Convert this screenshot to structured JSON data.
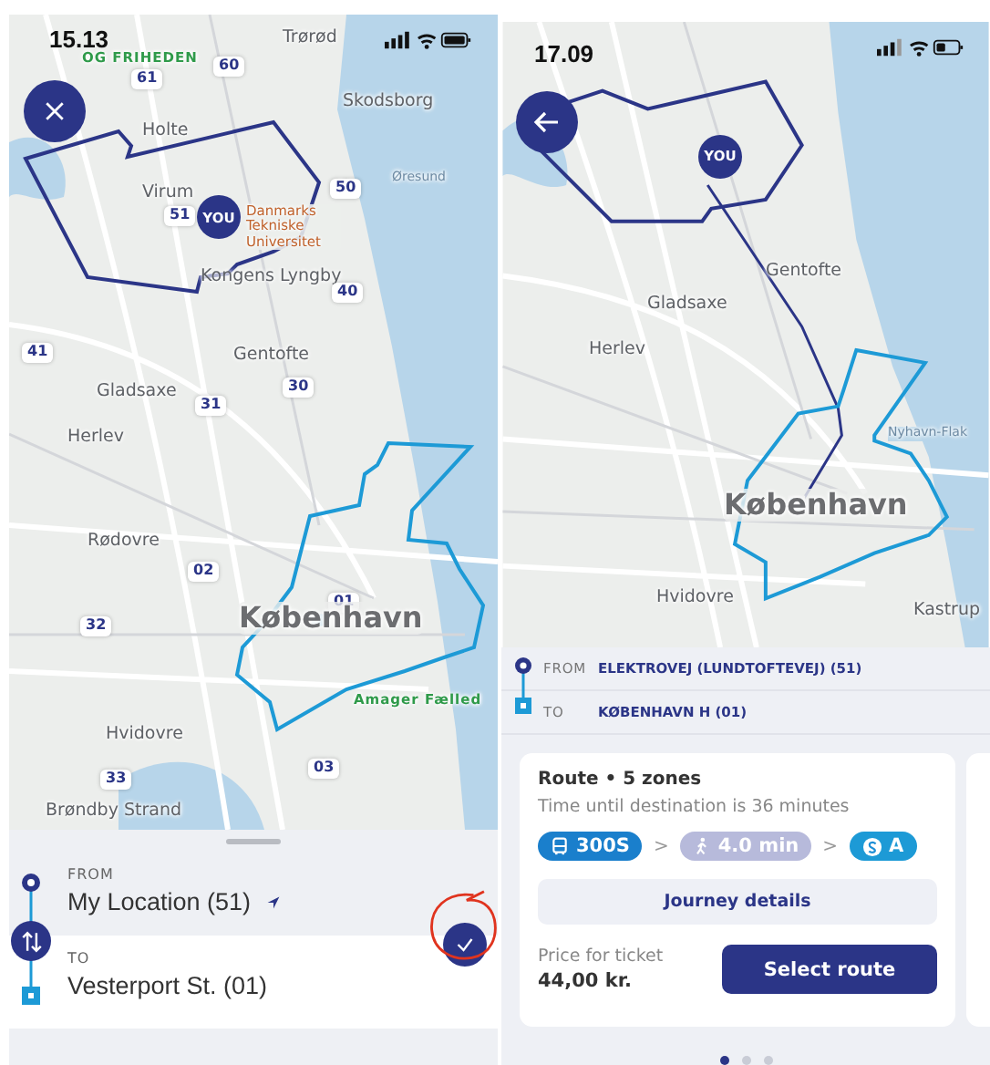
{
  "screens": [
    {
      "kind": "search",
      "status_bar": {
        "time": "15.13"
      },
      "map": {
        "you_marker": "YOU",
        "labels": [
          {
            "text": "Trørød",
            "kind": "place"
          },
          {
            "text": "OG FRIHEDEN",
            "kind": "park"
          },
          {
            "text": "61",
            "kind": "zone"
          },
          {
            "text": "60",
            "kind": "zone"
          },
          {
            "text": "Skodsborg",
            "kind": "place"
          },
          {
            "text": "Holte",
            "kind": "place"
          },
          {
            "text": "Øresund",
            "kind": "water"
          },
          {
            "text": "50",
            "kind": "zone"
          },
          {
            "text": "Virum",
            "kind": "place"
          },
          {
            "text": "51",
            "kind": "zone"
          },
          {
            "text": "Danmarks Tekniske Universitet",
            "kind": "institution"
          },
          {
            "text": "Kongens Lyngby",
            "kind": "place"
          },
          {
            "text": "40",
            "kind": "zone"
          },
          {
            "text": "41",
            "kind": "zone"
          },
          {
            "text": "Gentofte",
            "kind": "place"
          },
          {
            "text": "30",
            "kind": "zone"
          },
          {
            "text": "Gladsaxe",
            "kind": "place"
          },
          {
            "text": "31",
            "kind": "zone"
          },
          {
            "text": "Herlev",
            "kind": "place"
          },
          {
            "text": "Rødovre",
            "kind": "place"
          },
          {
            "text": "02",
            "kind": "zone"
          },
          {
            "text": "01",
            "kind": "zone"
          },
          {
            "text": "32",
            "kind": "zone"
          },
          {
            "text": "København",
            "kind": "city"
          },
          {
            "text": "Amager Fælled",
            "kind": "park"
          },
          {
            "text": "Hvidovre",
            "kind": "place"
          },
          {
            "text": "33",
            "kind": "zone"
          },
          {
            "text": "03",
            "kind": "zone"
          },
          {
            "text": "Brøndby Strand",
            "kind": "place"
          }
        ]
      },
      "sheet": {
        "from_label": "FROM",
        "from_value": "My Location (51)",
        "to_label": "TO",
        "to_value": "Vesterport St. (01)"
      }
    },
    {
      "kind": "route",
      "status_bar": {
        "time": "17.09"
      },
      "map": {
        "you_marker": "YOU",
        "labels": [
          {
            "text": "Gentofte",
            "kind": "place"
          },
          {
            "text": "Gladsaxe",
            "kind": "place"
          },
          {
            "text": "Herlev",
            "kind": "place"
          },
          {
            "text": "Nyhavn-Flak",
            "kind": "water"
          },
          {
            "text": "København",
            "kind": "city"
          },
          {
            "text": "Hvidovre",
            "kind": "place"
          },
          {
            "text": "Kastrup",
            "kind": "place"
          }
        ]
      },
      "sheet": {
        "from_label": "FROM",
        "from_value": "ELEKTROVEJ (LUNDTOFTEVEJ) (51)",
        "to_label": "TO",
        "to_value": "KØBENHAVN H (01)",
        "card": {
          "title": "Route • 5 zones",
          "subtitle": "Time until destination is 36 minutes",
          "legs": [
            {
              "kind": "bus",
              "text": "300S"
            },
            {
              "kind": "walk",
              "text": "4.0 min"
            },
            {
              "kind": "train",
              "text": "A"
            }
          ],
          "separators": [
            ">",
            ">"
          ],
          "details_button": "Journey details",
          "price_label": "Price for ticket",
          "price": "44,00 kr.",
          "select_button": "Select route"
        },
        "pages": [
          {
            "selected": true
          },
          {
            "selected": false
          },
          {
            "selected": false
          }
        ]
      }
    }
  ]
}
